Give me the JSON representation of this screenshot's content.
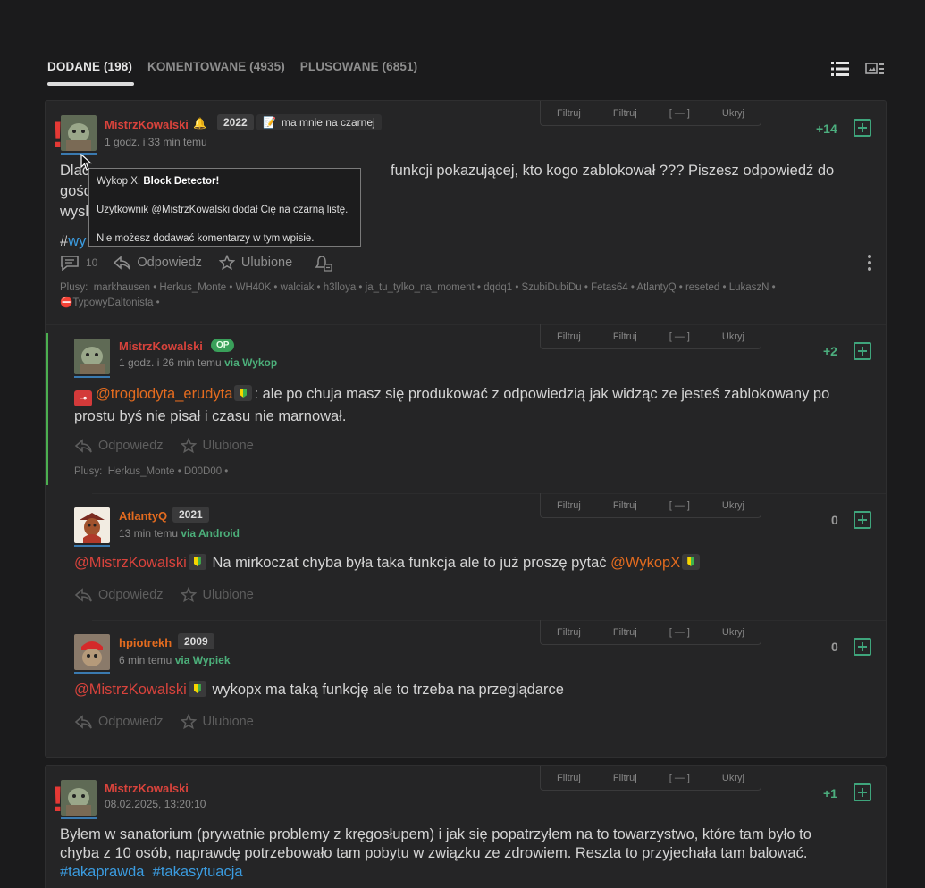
{
  "tabs": [
    {
      "label": "DODANE (198)"
    },
    {
      "label": "KOMENTOWANE (4935)"
    },
    {
      "label": "PLUSOWANE (6851)"
    }
  ],
  "filterbar": {
    "filtr1": "Filtruj",
    "filtr2": "Filtruj",
    "collapse": "[ — ]",
    "hide": "Ukryj"
  },
  "entry1": {
    "author": "MistrzKowalski",
    "year_badge": "2022",
    "blacklist_label": "ma mnie na czarnej",
    "time": "1 godz. i 33 min temu",
    "vote": "+14",
    "text_line1": "Dlac",
    "text_line1_rest": "funkcji pokazującej, kto kogo zablokował ??? Piszesz odpowiedź do gościa a tu",
    "text_line2": "wysk",
    "tag_hash": "#",
    "tag_part": "wy",
    "comments_count": "10",
    "reply_label": "Odpowiedz",
    "fav_label": "Ulubione",
    "plusy_label": "Plusy:",
    "plusy_line1": "markhausen • Herkus_Monte • WH40K • walciak • h3lloya • ja_tu_tylko_na_moment • dqdq1 • SzubiDubiDu • Fetas64 • AtlantyQ • reseted • LukaszN •",
    "plusy_line2": "TypowyDaltonista •"
  },
  "tooltip": {
    "title_prefix": "Wykop X: ",
    "title_bold": "Block Detector!",
    "line1": "Użytkownik @MistrzKowalski dodał Cię na czarną listę.",
    "line2": "Nie możesz dodawać komentarzy w tym wpisie."
  },
  "comment1": {
    "author": "MistrzKowalski",
    "op_badge": "OP",
    "time": "1 godz. i 26 min temu ",
    "via": "via Wykop",
    "vote": "+2",
    "mention": "@troglodyta_erudyta",
    "text_a": ": ale po chuja masz się produkować z odpowiedzią jak widząc ze jesteś zablokowany po",
    "text_b": "prostu byś nie pisał i czasu nie marnował.",
    "reply_label": "Odpowiedz",
    "fav_label": "Ulubione",
    "plusy_label": "Plusy:",
    "plusy": "Herkus_Monte • D00D00 •"
  },
  "comment2": {
    "author": "AtlantyQ",
    "year_badge": "2021",
    "time": "13 min temu ",
    "via": "via Android",
    "vote": "0",
    "mention1": "@MistrzKowalski",
    "text": " Na mirkoczat chyba była taka funkcja ale to już proszę pytać ",
    "mention2": "@WykopX",
    "reply_label": "Odpowiedz",
    "fav_label": "Ulubione"
  },
  "comment3": {
    "author": "hpiotrekh",
    "year_badge": "2009",
    "time": "6 min temu ",
    "via": "via Wypiek",
    "vote": "0",
    "mention": "@MistrzKowalski",
    "text": " wykopx ma taką funkcję ale to trzeba na przeglądarce",
    "reply_label": "Odpowiedz",
    "fav_label": "Ulubione"
  },
  "entry2": {
    "author": "MistrzKowalski",
    "time": "08.02.2025, 13:20:10",
    "vote": "+1",
    "text_line1": "Byłem w sanatorium (prywatnie problemy z kręgosłupem) i jak się popatrzyłem na to towarzystwo, które tam było to",
    "text_line2": "chyba z 10 osób, naprawdę potrzebowało tam pobytu w związku ze zdrowiem. Reszta to przyjechała tam balować.",
    "tag1": "#takaprawda",
    "tag2": "#takasytuacja"
  }
}
